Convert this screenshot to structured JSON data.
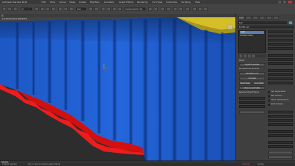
{
  "window": {
    "app_title": "Autodesk 3ds Max 2016",
    "menu_items": [
      "Edit",
      "Tools",
      "Group",
      "Views",
      "Create",
      "Modifiers",
      "Animation",
      "Graph Editors",
      "Rendering",
      "Civil View",
      "Customize",
      "Scripting",
      "Help"
    ]
  },
  "toolbar": {
    "selection_filter": "All",
    "view_dropdown": "View",
    "named_selection": "Create Selection Set"
  },
  "viewport": {
    "label": "[+] [Perspective] [Realistic]",
    "cloth_blue": "#1f5fd0",
    "cloth_red": "#e01414",
    "table_top": "#d8c22a"
  },
  "command_panel": {
    "object_name": "Skirt",
    "modifier_list": "Modifier List",
    "stack_items": [
      "Cloth",
      "Editable Mesh"
    ],
    "rollouts": [
      "Object",
      "Object Properties",
      "Simulation Parameters",
      "Selected Object Manip"
    ],
    "buttons": [
      "Simulate Local",
      "Simulate",
      "Reset State",
      "Grab State",
      "Show Current State"
    ],
    "options": [
      "Use Target State",
      "Self Collision",
      "Check Intersections",
      "Solid Collision"
    ]
  },
  "status": {
    "selection": "1 Object Selected",
    "prompt": "Click or click-and-drag to select objects",
    "auto_key": "Auto Key",
    "set_key": "Set Key"
  }
}
